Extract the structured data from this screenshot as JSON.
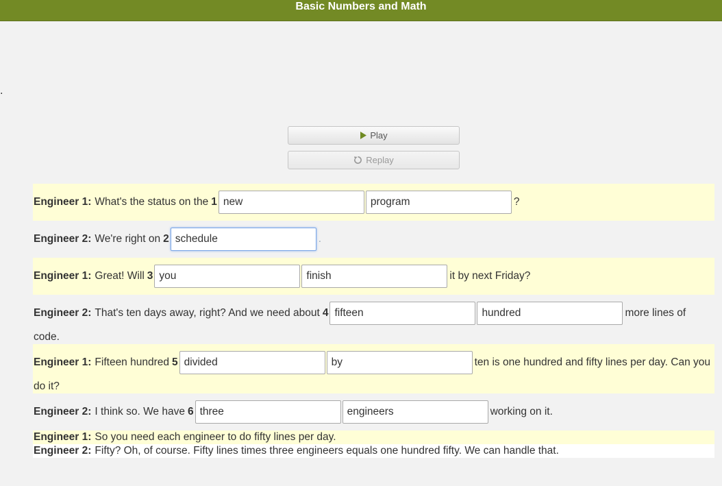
{
  "header": {
    "title": "Basic Numbers and Math"
  },
  "stray_text": ".",
  "controls": {
    "play_label": "Play",
    "replay_label": "Replay"
  },
  "dialogue": [
    {
      "speaker": "Engineer 1:",
      "before": "What's the status on the",
      "number": "1",
      "answers": [
        "new",
        "program"
      ],
      "after": "?",
      "continuation": ""
    },
    {
      "speaker": "Engineer 2:",
      "before": "We're right on",
      "number": "2",
      "answers": [
        "schedule"
      ],
      "after": ".",
      "continuation": ""
    },
    {
      "speaker": "Engineer 1:",
      "before": "Great! Will",
      "number": "3",
      "answers": [
        "you",
        "finish"
      ],
      "after": "it by next Friday?",
      "continuation": ""
    },
    {
      "speaker": "Engineer 2:",
      "before": "That's ten days away, right? And we need about",
      "number": "4",
      "answers": [
        "fifteen",
        "hundred"
      ],
      "after": "more lines of",
      "continuation": "code."
    },
    {
      "speaker": "Engineer 1:",
      "before": "Fifteen hundred",
      "number": "5",
      "answers": [
        "divided",
        "by"
      ],
      "after": "ten is one hundred and fifty lines per day. Can you",
      "continuation": "do it?"
    },
    {
      "speaker": "Engineer 2:",
      "before": "I think so. We have",
      "number": "6",
      "answers": [
        "three",
        "engineers"
      ],
      "after": "working on it.",
      "continuation": ""
    },
    {
      "speaker": "Engineer 1:",
      "text": "So you need each engineer to do fifty lines per day."
    },
    {
      "speaker": "Engineer 2:",
      "text": "Fifty? Oh, of course. Fifty lines times three engineers equals one hundred fifty. We can handle that."
    }
  ]
}
